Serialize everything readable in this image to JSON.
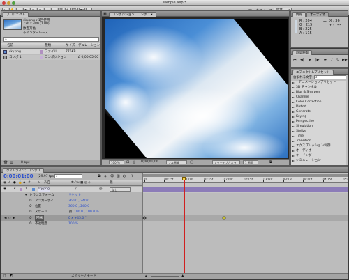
{
  "window": {
    "title": "sample.aep *"
  },
  "toolbar": {
    "workspace_label": "ワークスペース",
    "workspace_value": "標準",
    "tools": [
      "selection",
      "hand",
      "zoom",
      "rotate",
      "camera",
      "pan-behind",
      "mask",
      "pen",
      "type",
      "brush",
      "clone",
      "eraser",
      "puppet"
    ]
  },
  "project": {
    "tab": "プロジェクト",
    "preview_name": "sky.png ▾ 1回使用",
    "preview_dims": "720 x 480 (1.00)",
    "preview_colors": "数百万色",
    "preview_interlace": "非インターレース",
    "columns": [
      "名前",
      "種類",
      "サイズ",
      "デュレーション"
    ],
    "items": [
      {
        "name": "sky.png",
        "type": "ファイル",
        "size": "776KB",
        "duration": ""
      },
      {
        "name": "コンポ 1",
        "type": "コンポジション",
        "size": "",
        "duration": "Δ 0;00;05;00"
      }
    ],
    "footer": "8 bpc"
  },
  "composition": {
    "tab": "コンポジション：コンポ 1",
    "tab_menu": "▾",
    "footer": {
      "zoom": "100 %",
      "time": "0;00;01;00",
      "resolution": "フル画質",
      "view": "アクティブカメラ",
      "views": "1 画面"
    }
  },
  "info": {
    "tabs": [
      "情報",
      "オーディオ"
    ],
    "r": "R : 204",
    "g": "G : 215",
    "b": "B : 225",
    "a": "A : 115",
    "x": "X : 36",
    "y": "Y : 155"
  },
  "time_controls": {
    "tab": "時間制御"
  },
  "effects": {
    "tab": "エフェクト&プリセット",
    "search_label": "含まれる文字",
    "items": [
      "* アニメーションプリセット",
      "3D チャンネル",
      "Blur & Sharpen",
      "Channel",
      "Color Correction",
      "Distort",
      "Generate",
      "Keying",
      "Perspective",
      "Simulation",
      "Stylize",
      "Time",
      "Transition",
      "エクスプレッション制御",
      "オーディオ",
      "キーイング",
      "シミュレーション"
    ]
  },
  "timeline": {
    "tab": "タイムライン：コンポ 1",
    "timecode": "0;00;01;00",
    "fps": "(29.97 fps)",
    "columns": {
      "source": "ソース名",
      "parent": "親"
    },
    "layer": {
      "index": "1",
      "name": "sky.png",
      "parent": "なし"
    },
    "transform_label": "トランスフォーム",
    "transform_reset": "リセット",
    "properties": [
      {
        "name": "アンカーポイ…",
        "value": "360.0 , 240.0"
      },
      {
        "name": "位置",
        "value": "360.0 , 240.0"
      },
      {
        "name": "スケール",
        "value": "100.0 , 100.0 %"
      },
      {
        "name": "回転",
        "value": "0 x +45.0 °"
      },
      {
        "name": "不透明度",
        "value": "100 %"
      }
    ],
    "ruler": [
      "0f",
      "00:15f",
      "01:00f",
      "01:15f",
      "02:00f",
      "02:15f",
      "03:00f",
      "03:15f",
      "04:00f",
      "04:15f",
      "05:0"
    ],
    "current_time_fraction": 0.2,
    "keyframes": [
      0.0,
      0.4
    ],
    "footer_toggle": "スイッチ / モード"
  }
}
